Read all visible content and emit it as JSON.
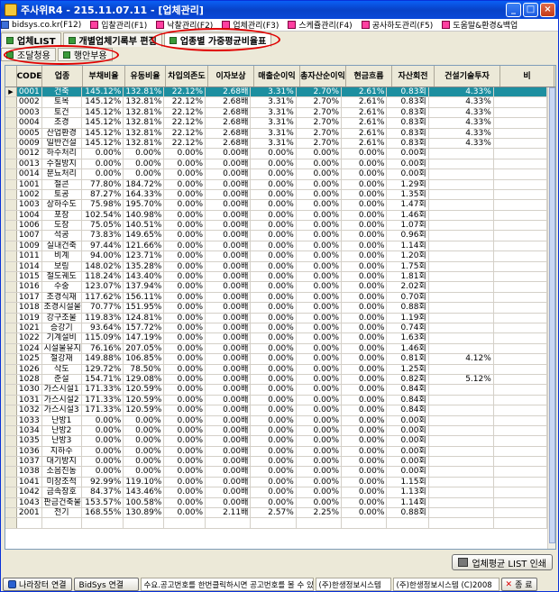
{
  "window": {
    "title": "주사위R4 - 215.11.07.11 - [업체관리]"
  },
  "menu": [
    {
      "label": "bidsys.co.kr(F12)",
      "color": "blue"
    },
    {
      "label": "입찰관리(F1)",
      "color": "pink"
    },
    {
      "label": "낙찰관리(F2)",
      "color": "pink"
    },
    {
      "label": "업체관리(F3)",
      "color": "pink"
    },
    {
      "label": "스케쥴관리(F4)",
      "color": "pink"
    },
    {
      "label": "공사하도관리(F5)",
      "color": "pink"
    },
    {
      "label": "도움말&환경&백업",
      "color": "pink"
    }
  ],
  "tabs": [
    "업체LIST",
    "개별업체기록부 편집",
    "업종별 가중평균비율표"
  ],
  "subtabs": [
    "조달청용",
    "행안부용"
  ],
  "grid": {
    "headers": [
      "CODE",
      "업종",
      "부채비율",
      "유동비율",
      "차입의존도",
      "이자보상",
      "매출순이익",
      "총자산순이익",
      "현금흐름",
      "자산회전",
      "건설기술투자",
      "비"
    ],
    "rows": [
      [
        "0001",
        "건축",
        "145.12%",
        "132.81%",
        "22.12%",
        "2.68배",
        "3.31%",
        "2.70%",
        "2.61%",
        "0.83회",
        "4.33%"
      ],
      [
        "0002",
        "토목",
        "145.12%",
        "132.81%",
        "22.12%",
        "2.68배",
        "3.31%",
        "2.70%",
        "2.61%",
        "0.83회",
        "4.33%"
      ],
      [
        "0003",
        "토건",
        "145.12%",
        "132.81%",
        "22.12%",
        "2.68배",
        "3.31%",
        "2.70%",
        "2.61%",
        "0.83회",
        "4.33%"
      ],
      [
        "0004",
        "조경",
        "145.12%",
        "132.81%",
        "22.12%",
        "2.68배",
        "3.31%",
        "2.70%",
        "2.61%",
        "0.83회",
        "4.33%"
      ],
      [
        "0005",
        "산업환경",
        "145.12%",
        "132.81%",
        "22.12%",
        "2.68배",
        "3.31%",
        "2.70%",
        "2.61%",
        "0.83회",
        "4.33%"
      ],
      [
        "0009",
        "일반건설",
        "145.12%",
        "132.81%",
        "22.12%",
        "2.68배",
        "3.31%",
        "2.70%",
        "2.61%",
        "0.83회",
        "4.33%"
      ],
      [
        "0012",
        "하수처리",
        "0.00%",
        "0.00%",
        "0.00%",
        "0.00배",
        "0.00%",
        "0.00%",
        "0.00%",
        "0.00회",
        ""
      ],
      [
        "0013",
        "수질방지",
        "0.00%",
        "0.00%",
        "0.00%",
        "0.00배",
        "0.00%",
        "0.00%",
        "0.00%",
        "0.00회",
        ""
      ],
      [
        "0014",
        "분뇨처리",
        "0.00%",
        "0.00%",
        "0.00%",
        "0.00배",
        "0.00%",
        "0.00%",
        "0.00%",
        "0.00회",
        ""
      ],
      [
        "1001",
        "철콘",
        "77.80%",
        "184.72%",
        "0.00%",
        "0.00배",
        "0.00%",
        "0.00%",
        "0.00%",
        "1.29회",
        ""
      ],
      [
        "1002",
        "토공",
        "87.27%",
        "164.33%",
        "0.00%",
        "0.00배",
        "0.00%",
        "0.00%",
        "0.00%",
        "1.35회",
        ""
      ],
      [
        "1003",
        "상하수도",
        "75.98%",
        "195.70%",
        "0.00%",
        "0.00배",
        "0.00%",
        "0.00%",
        "0.00%",
        "1.47회",
        ""
      ],
      [
        "1004",
        "포장",
        "102.54%",
        "140.98%",
        "0.00%",
        "0.00배",
        "0.00%",
        "0.00%",
        "0.00%",
        "1.46회",
        ""
      ],
      [
        "1006",
        "도장",
        "75.05%",
        "140.51%",
        "0.00%",
        "0.00배",
        "0.00%",
        "0.00%",
        "0.00%",
        "1.07회",
        ""
      ],
      [
        "1007",
        "석공",
        "73.83%",
        "149.65%",
        "0.00%",
        "0.00배",
        "0.00%",
        "0.00%",
        "0.00%",
        "0.96회",
        ""
      ],
      [
        "1009",
        "실내건축",
        "97.44%",
        "121.66%",
        "0.00%",
        "0.00배",
        "0.00%",
        "0.00%",
        "0.00%",
        "1.14회",
        ""
      ],
      [
        "1011",
        "비계",
        "94.00%",
        "123.71%",
        "0.00%",
        "0.00배",
        "0.00%",
        "0.00%",
        "0.00%",
        "1.20회",
        ""
      ],
      [
        "1014",
        "보링",
        "148.02%",
        "135.28%",
        "0.00%",
        "0.00배",
        "0.00%",
        "0.00%",
        "0.00%",
        "1.75회",
        ""
      ],
      [
        "1015",
        "철도궤도",
        "118.24%",
        "143.40%",
        "0.00%",
        "0.00배",
        "0.00%",
        "0.00%",
        "0.00%",
        "1.81회",
        ""
      ],
      [
        "1016",
        "수중",
        "123.07%",
        "137.94%",
        "0.00%",
        "0.00배",
        "0.00%",
        "0.00%",
        "0.00%",
        "2.02회",
        ""
      ],
      [
        "1017",
        "조경식재",
        "117.62%",
        "156.11%",
        "0.00%",
        "0.00배",
        "0.00%",
        "0.00%",
        "0.00%",
        "0.70회",
        ""
      ],
      [
        "1018",
        "조경시설물",
        "70.77%",
        "151.95%",
        "0.00%",
        "0.00배",
        "0.00%",
        "0.00%",
        "0.00%",
        "0.88회",
        ""
      ],
      [
        "1019",
        "강구조물",
        "119.83%",
        "124.81%",
        "0.00%",
        "0.00배",
        "0.00%",
        "0.00%",
        "0.00%",
        "1.19회",
        ""
      ],
      [
        "1021",
        "승강기",
        "93.64%",
        "157.72%",
        "0.00%",
        "0.00배",
        "0.00%",
        "0.00%",
        "0.00%",
        "0.74회",
        ""
      ],
      [
        "1022",
        "기계설비",
        "115.09%",
        "147.19%",
        "0.00%",
        "0.00배",
        "0.00%",
        "0.00%",
        "0.00%",
        "1.63회",
        ""
      ],
      [
        "1024",
        "시설물유지",
        "76.16%",
        "207.05%",
        "0.00%",
        "0.00배",
        "0.00%",
        "0.00%",
        "0.00%",
        "1.46회",
        ""
      ],
      [
        "1025",
        "철강재",
        "149.88%",
        "106.85%",
        "0.00%",
        "0.00배",
        "0.00%",
        "0.00%",
        "0.00%",
        "0.81회",
        "4.12%"
      ],
      [
        "1026",
        "삭도",
        "129.72%",
        "78.50%",
        "0.00%",
        "0.00배",
        "0.00%",
        "0.00%",
        "0.00%",
        "1.25회",
        ""
      ],
      [
        "1028",
        "준설",
        "154.71%",
        "129.08%",
        "0.00%",
        "0.00배",
        "0.00%",
        "0.00%",
        "0.00%",
        "0.82회",
        "5.12%"
      ],
      [
        "1030",
        "가스시설1",
        "171.33%",
        "120.59%",
        "0.00%",
        "0.00배",
        "0.00%",
        "0.00%",
        "0.00%",
        "0.84회",
        ""
      ],
      [
        "1031",
        "가스시설2",
        "171.33%",
        "120.59%",
        "0.00%",
        "0.00배",
        "0.00%",
        "0.00%",
        "0.00%",
        "0.84회",
        ""
      ],
      [
        "1032",
        "가스시설3",
        "171.33%",
        "120.59%",
        "0.00%",
        "0.00배",
        "0.00%",
        "0.00%",
        "0.00%",
        "0.84회",
        ""
      ],
      [
        "1033",
        "난방1",
        "0.00%",
        "0.00%",
        "0.00%",
        "0.00배",
        "0.00%",
        "0.00%",
        "0.00%",
        "0.00회",
        ""
      ],
      [
        "1034",
        "난방2",
        "0.00%",
        "0.00%",
        "0.00%",
        "0.00배",
        "0.00%",
        "0.00%",
        "0.00%",
        "0.00회",
        ""
      ],
      [
        "1035",
        "난방3",
        "0.00%",
        "0.00%",
        "0.00%",
        "0.00배",
        "0.00%",
        "0.00%",
        "0.00%",
        "0.00회",
        ""
      ],
      [
        "1036",
        "지하수",
        "0.00%",
        "0.00%",
        "0.00%",
        "0.00배",
        "0.00%",
        "0.00%",
        "0.00%",
        "0.00회",
        ""
      ],
      [
        "1037",
        "대기방지",
        "0.00%",
        "0.00%",
        "0.00%",
        "0.00배",
        "0.00%",
        "0.00%",
        "0.00%",
        "0.00회",
        ""
      ],
      [
        "1038",
        "소음진동",
        "0.00%",
        "0.00%",
        "0.00%",
        "0.00배",
        "0.00%",
        "0.00%",
        "0.00%",
        "0.00회",
        ""
      ],
      [
        "1041",
        "미장조적",
        "92.99%",
        "119.10%",
        "0.00%",
        "0.00배",
        "0.00%",
        "0.00%",
        "0.00%",
        "1.15회",
        ""
      ],
      [
        "1042",
        "금속창호",
        "84.37%",
        "143.46%",
        "0.00%",
        "0.00배",
        "0.00%",
        "0.00%",
        "0.00%",
        "1.13회",
        ""
      ],
      [
        "1043",
        "판금건축물",
        "153.57%",
        "100.58%",
        "0.00%",
        "0.00배",
        "0.00%",
        "0.00%",
        "0.00%",
        "1.14회",
        ""
      ],
      [
        "2001",
        "전기",
        "168.55%",
        "130.89%",
        "0.00%",
        "2.11배",
        "2.57%",
        "2.25%",
        "0.00%",
        "0.88회",
        ""
      ],
      [
        "",
        "",
        "",
        "",
        "",
        "",
        "",
        "",
        "",
        "",
        ""
      ]
    ]
  },
  "buttons": {
    "print": "업체평균 LIST 인쇄"
  },
  "status": {
    "btn1": "나라장터 연결",
    "btn2": "BidSys 연결",
    "message": "수요.공고번호를 한번클릭하시면 공고번호를 볼 수 있으며, 더블클릭시 공고내용을 볼 수 있습니다",
    "company1": "(주)한생정보시스템",
    "company2": "(주)한생정보시스템 (C)2008",
    "close": "종 료"
  },
  "colors": {
    "selected_row": "#1d8fa0",
    "highlight_circle": "#e00000",
    "title_bar": "#0842c8"
  }
}
